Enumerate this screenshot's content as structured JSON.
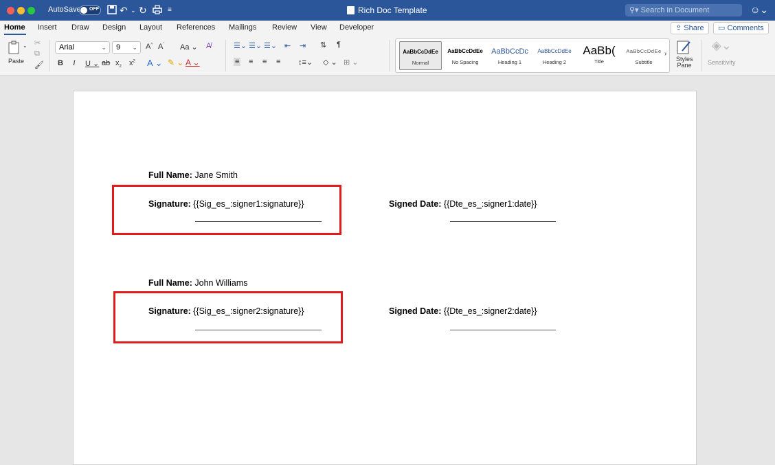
{
  "titlebar": {
    "autosave_label": "AutoSave",
    "autosave_state": "OFF",
    "doc_title": "Rich Doc Template",
    "search_placeholder": "Search in Document"
  },
  "tabs": [
    "Home",
    "Insert",
    "Draw",
    "Design",
    "Layout",
    "References",
    "Mailings",
    "Review",
    "View",
    "Developer"
  ],
  "tab_buttons": {
    "share": "Share",
    "comments": "Comments"
  },
  "ribbon": {
    "paste_label": "Paste",
    "font_name": "Arial",
    "font_size": "9",
    "styles": [
      {
        "sample": "AaBbCcDdEe",
        "name": "Normal"
      },
      {
        "sample": "AaBbCcDdEe",
        "name": "No Spacing"
      },
      {
        "sample": "AaBbCcDc",
        "name": "Heading 1"
      },
      {
        "sample": "AaBbCcDdEe",
        "name": "Heading 2"
      },
      {
        "sample": "AaBb(",
        "name": "Title"
      },
      {
        "sample": "AaBbCcDdEe",
        "name": "Subtitle"
      }
    ],
    "styles_pane_label": "Styles\nPane",
    "sensitivity_label": "Sensitivity"
  },
  "document": {
    "signer1": {
      "full_name_label": "Full Name:",
      "full_name": "Jane Smith",
      "signature_label": "Signature:",
      "signature_tag": "{{Sig_es_:signer1:signature}}",
      "date_label": "Signed Date:",
      "date_tag": "{{Dte_es_:signer1:date}}"
    },
    "signer2": {
      "full_name_label": "Full Name:",
      "full_name": "John Williams",
      "signature_label": "Signature:",
      "signature_tag": "{{Sig_es_:signer2:signature}}",
      "date_label": "Signed Date:",
      "date_tag": "{{Dte_es_:signer2:date}}"
    }
  },
  "colors": {
    "titlebar": "#2b579a",
    "highlight_box": "#e01b1b"
  }
}
